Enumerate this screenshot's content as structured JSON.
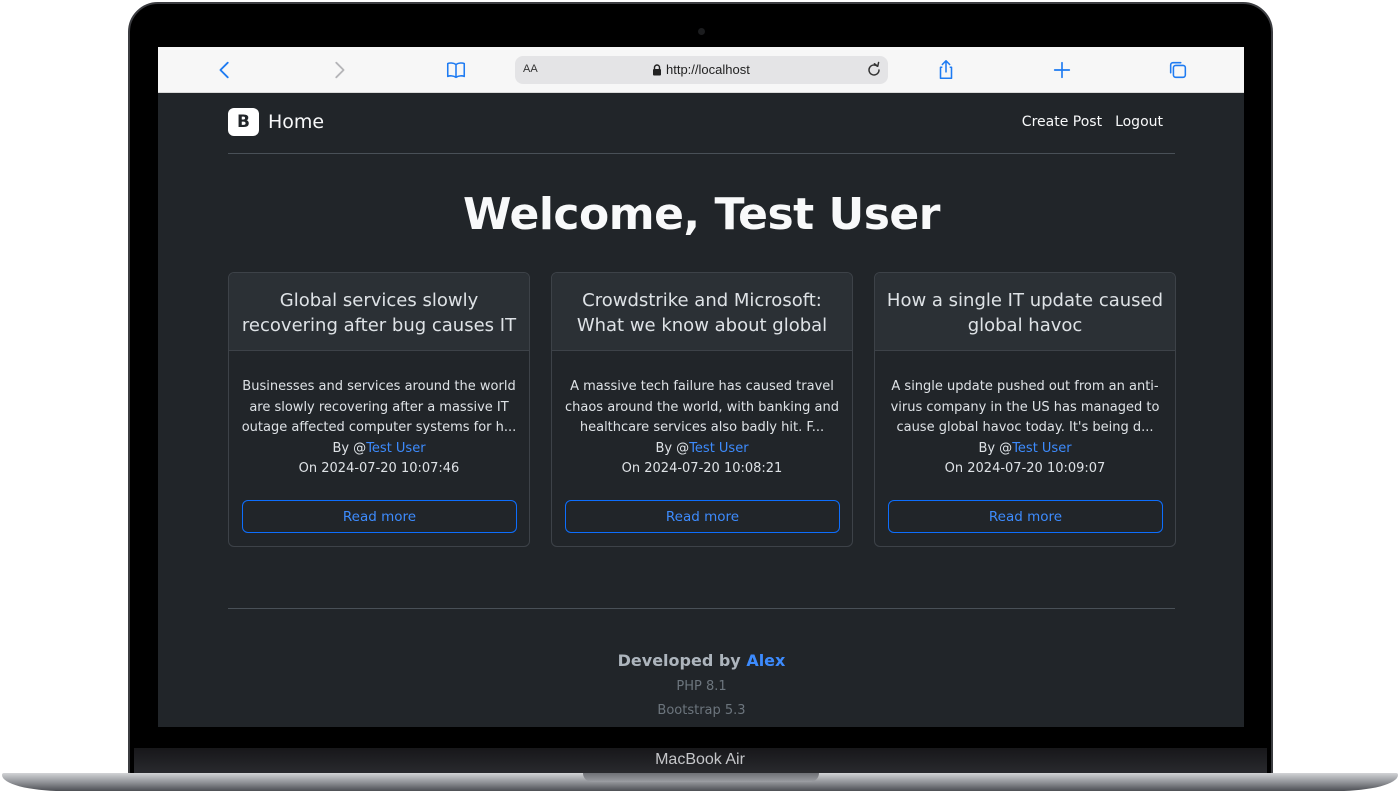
{
  "device": {
    "model": "MacBook Air"
  },
  "browser": {
    "text_size_label": "AA",
    "url": "http://localhost"
  },
  "navbar": {
    "brand_logo": "B",
    "brand": "Home",
    "links": [
      "Create Post",
      "Logout"
    ]
  },
  "welcome": "Welcome, Test User",
  "posts": [
    {
      "title": "Global services slowly recovering after bug causes IT",
      "excerpt": "Businesses and services around the world are slowly recovering after a massive IT outage affected computer systems for h...",
      "by_prefix": "By @",
      "author": "Test User",
      "date": "On 2024-07-20 10:07:46",
      "button": "Read more"
    },
    {
      "title": "Crowdstrike and Microsoft: What we know about global",
      "excerpt": "A massive tech failure has caused travel chaos around the world, with banking and healthcare services also badly hit. F...",
      "by_prefix": "By @",
      "author": "Test User",
      "date": "On 2024-07-20 10:08:21",
      "button": "Read more"
    },
    {
      "title": "How a single IT update caused global havoc",
      "excerpt": "A single update pushed out from an anti-virus company in the US has managed to cause global havoc today. It's being d...",
      "by_prefix": "By @",
      "author": "Test User",
      "date": "On 2024-07-20 10:09:07",
      "button": "Read more"
    }
  ],
  "footer": {
    "developed_by": "Developed by",
    "developer": "Alex",
    "line2": "PHP 8.1",
    "line3": "Bootstrap 5.3"
  },
  "colors": {
    "page_bg": "#212529",
    "accent": "#0d6efd",
    "link": "#3d8bfd"
  }
}
